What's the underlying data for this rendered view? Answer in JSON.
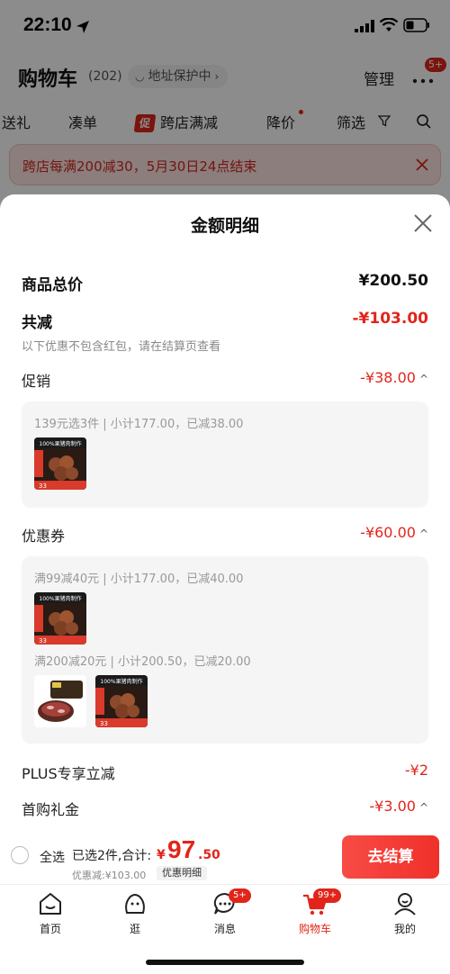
{
  "status_bar": {
    "time": "22:10"
  },
  "cart_header": {
    "title": "购物车",
    "count": "(202)",
    "address_protect": "地址保护中",
    "manage": "管理",
    "more_badge": "5+"
  },
  "filter_bar": {
    "items": [
      "送礼",
      "凑单",
      "跨店满减",
      "降价",
      "筛选"
    ],
    "promo_tag": "促"
  },
  "notice": {
    "text": "跨店每满200减30，5月30日24点结束"
  },
  "sheet": {
    "title": "金额明细",
    "goods_total_label": "商品总价",
    "goods_total_value": "¥200.50",
    "total_discount_label": "共减",
    "total_discount_value": "-¥103.00",
    "discount_note": "以下优惠不包含红包，请在结算页查看",
    "promotion_label": "促销",
    "promotion_value": "-¥38.00",
    "promotion_detail": "139元选3件 | 小计177.00，已减38.00",
    "coupon_label": "优惠券",
    "coupon_value": "-¥60.00",
    "coupon_detail_1": "满99减40元 | 小计177.00，已减40.00",
    "coupon_detail_2": "满200减20元 | 小计200.50，已减20.00",
    "plus_label": "PLUS专享立减",
    "plus_value": "-¥2",
    "first_purchase_label": "首购礼金",
    "first_purchase_value": "-¥3.00",
    "product_thumb_text": "100%果猪肉制作",
    "product_thumb_tag": "33"
  },
  "checkout": {
    "select_all": "全选",
    "selected_summary": "已选2件,合计:",
    "currency": "¥",
    "total_int": "97",
    "total_dec": ".50",
    "discount_line": "优惠减:¥103.00",
    "discount_detail": "优惠明细",
    "checkout_button": "去结算"
  },
  "tab_bar": {
    "tabs": [
      {
        "label": "首页",
        "icon": "home-icon"
      },
      {
        "label": "逛",
        "icon": "browse-icon"
      },
      {
        "label": "消息",
        "icon": "message-icon",
        "badge": "5+"
      },
      {
        "label": "购物车",
        "icon": "cart-icon",
        "badge": "99+",
        "active": true
      },
      {
        "label": "我的",
        "icon": "profile-icon"
      }
    ]
  },
  "colors": {
    "accent": "#e1251b",
    "background": "#ffffff",
    "panel": "#f5f5f5"
  }
}
